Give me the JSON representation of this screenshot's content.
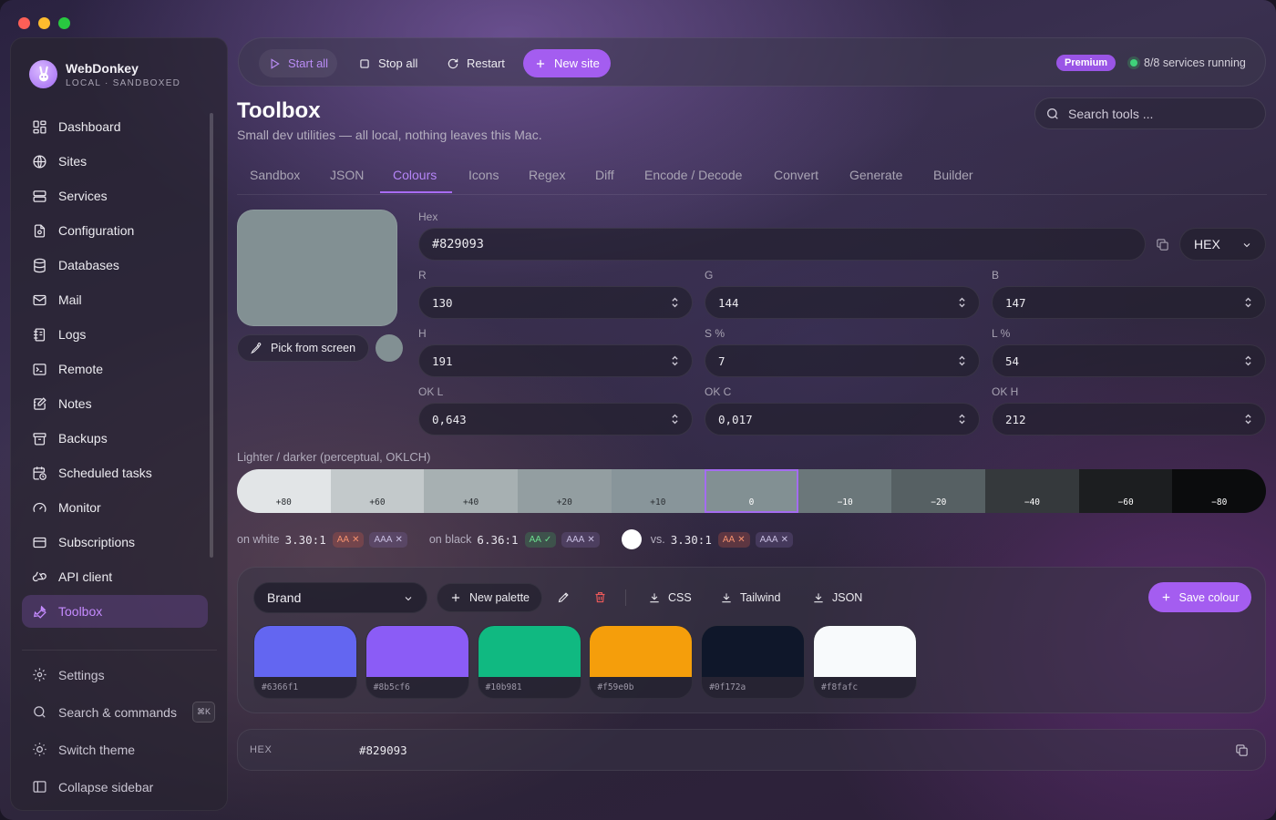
{
  "app": {
    "name": "WebDonkey",
    "subtitle": "LOCAL · SANDBOXED"
  },
  "sidebar": {
    "items": [
      {
        "label": "Dashboard",
        "icon": "dashboard-icon"
      },
      {
        "label": "Sites",
        "icon": "globe-icon"
      },
      {
        "label": "Services",
        "icon": "server-icon"
      },
      {
        "label": "Configuration",
        "icon": "config-file-icon"
      },
      {
        "label": "Databases",
        "icon": "database-icon"
      },
      {
        "label": "Mail",
        "icon": "mail-icon"
      },
      {
        "label": "Logs",
        "icon": "logs-icon"
      },
      {
        "label": "Remote",
        "icon": "terminal-icon"
      },
      {
        "label": "Notes",
        "icon": "notes-icon"
      },
      {
        "label": "Backups",
        "icon": "archive-icon"
      },
      {
        "label": "Scheduled tasks",
        "icon": "calendar-clock-icon"
      },
      {
        "label": "Monitor",
        "icon": "gauge-icon"
      },
      {
        "label": "Subscriptions",
        "icon": "card-icon"
      },
      {
        "label": "API client",
        "icon": "webhook-icon"
      },
      {
        "label": "Toolbox",
        "icon": "wrench-icon",
        "active": true
      }
    ],
    "bottom": [
      {
        "label": "Settings",
        "icon": "gear-icon"
      },
      {
        "label": "Search & commands",
        "icon": "search-icon",
        "shortcut": "⌘K"
      },
      {
        "label": "Switch theme",
        "icon": "sun-icon"
      },
      {
        "label": "Collapse sidebar",
        "icon": "sidebar-icon"
      }
    ]
  },
  "toolbar": {
    "start_all": "Start all",
    "stop_all": "Stop all",
    "restart": "Restart",
    "new_site": "New site",
    "premium": "Premium",
    "status": "8/8 services running"
  },
  "header": {
    "title": "Toolbox",
    "subtitle": "Small dev utilities — all local, nothing leaves this Mac.",
    "search_placeholder": "Search tools ..."
  },
  "tabs": [
    "Sandbox",
    "JSON",
    "Colours",
    "Icons",
    "Regex",
    "Diff",
    "Encode / Decode",
    "Convert",
    "Generate",
    "Builder"
  ],
  "active_tab": "Colours",
  "colour": {
    "preview": "#829093",
    "pick_label": "Pick from screen",
    "hex_label": "Hex",
    "hex": "#829093",
    "format": "HEX",
    "r_label": "R",
    "r": "130",
    "g_label": "G",
    "g": "144",
    "b_label": "B",
    "b": "147",
    "h_label": "H",
    "h": "191",
    "s_label": "S %",
    "s": "7",
    "l_label": "L %",
    "l": "54",
    "okl_label": "OK L",
    "okl": "0,643",
    "okc_label": "OK C",
    "okc": "0,017",
    "okh_label": "OK H",
    "okh": "212"
  },
  "scale": {
    "label": "Lighter / darker (perceptual, OKLCH)",
    "steps": [
      {
        "label": "+80",
        "color": "#e2e5e7",
        "text": "#2b2f33"
      },
      {
        "label": "+60",
        "color": "#c3c9cb",
        "text": "#2b2f33"
      },
      {
        "label": "+40",
        "color": "#a7b0b2",
        "text": "#2b2f33"
      },
      {
        "label": "+20",
        "color": "#939ea1",
        "text": "#2b2f33"
      },
      {
        "label": "+10",
        "color": "#88959a",
        "text": "#2b2f33"
      },
      {
        "label": "0",
        "color": "#829093",
        "text": "#ffffff",
        "selected": true
      },
      {
        "label": "−10",
        "color": "#6b777a",
        "text": "#ffffff"
      },
      {
        "label": "−20",
        "color": "#566063",
        "text": "#ffffff"
      },
      {
        "label": "−40",
        "color": "#35393c",
        "text": "#ffffff"
      },
      {
        "label": "−60",
        "color": "#1c1e20",
        "text": "#ffffff"
      },
      {
        "label": "−80",
        "color": "#0b0c0d",
        "text": "#ffffff"
      }
    ]
  },
  "contrast": {
    "white_label": "on white",
    "white_ratio": "3.30:1",
    "black_label": "on black",
    "black_ratio": "6.36:1",
    "vs_label": "vs.",
    "vs_ratio": "3.30:1",
    "aa": "AA",
    "aaa": "AAA"
  },
  "palette": {
    "selected": "Brand",
    "new_palette": "New palette",
    "export_css": "CSS",
    "export_tailwind": "Tailwind",
    "export_json": "JSON",
    "save": "Save colour",
    "colors": [
      {
        "hex": "#6366f1"
      },
      {
        "hex": "#8b5cf6"
      },
      {
        "hex": "#10b981"
      },
      {
        "hex": "#f59e0b"
      },
      {
        "hex": "#0f172a"
      },
      {
        "hex": "#f8fafc"
      }
    ]
  },
  "output": {
    "label": "HEX",
    "value": "#829093"
  },
  "colors": {
    "accent": "#a45df0",
    "accent_text": "#b585f7",
    "success": "#3fd27a"
  }
}
